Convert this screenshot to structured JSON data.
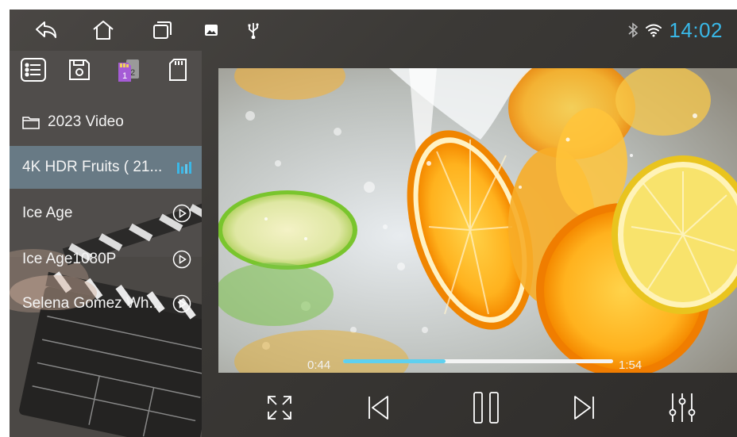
{
  "status": {
    "time": "14:02",
    "accent": "#39b8e8"
  },
  "sidebar": {
    "folder": "2023 Video",
    "items": [
      {
        "label": "4K HDR Fruits ( 21...",
        "active": true
      },
      {
        "label": "Ice Age",
        "active": false
      },
      {
        "label": "Ice Age1080P",
        "active": false
      },
      {
        "label": "Selena Gomez  Wh...",
        "active": false
      }
    ]
  },
  "player": {
    "elapsed": "0:44",
    "duration": "1:54",
    "progress": 0.38,
    "progress_color": "#5fd0ef"
  },
  "icons": [
    "back-icon",
    "home-icon",
    "recent-apps-icon",
    "gallery-icon",
    "usb-icon",
    "bluetooth-icon",
    "wifi-icon",
    "playlist-icon",
    "floppy-icon",
    "sd-card-1-2-icon",
    "sd-card-icon",
    "folder-icon",
    "equalizer-bars-icon",
    "play-circle-icon",
    "fullscreen-icon",
    "previous-icon",
    "pause-icon",
    "next-icon",
    "equalizer-sliders-icon"
  ]
}
